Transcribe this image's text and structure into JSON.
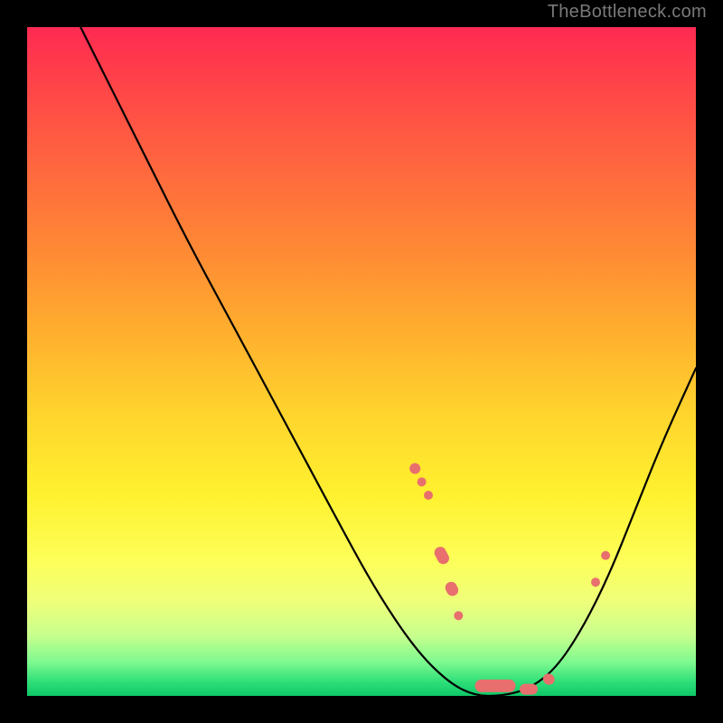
{
  "watermark": "TheBottleneck.com",
  "gradient_colors": {
    "top": "#ff2a52",
    "mid": "#ffd52d",
    "bottom": "#0dc867"
  },
  "chart_data": {
    "type": "line",
    "title": "",
    "xlabel": "",
    "ylabel": "",
    "xlim": [
      0,
      100
    ],
    "ylim": [
      0,
      100
    ],
    "series": [
      {
        "name": "bottleneck-curve",
        "color": "#000000",
        "x": [
          8,
          12,
          18,
          24,
          31,
          38,
          46,
          52,
          58,
          63,
          67,
          71,
          75,
          79,
          83,
          87,
          91,
          95,
          100
        ],
        "y": [
          100,
          92,
          80,
          68,
          55,
          42,
          27,
          16,
          7,
          2,
          0,
          0,
          1,
          4,
          10,
          18,
          28,
          38,
          49
        ]
      }
    ],
    "markers": [
      {
        "name": "mark-left-a",
        "x": 58,
        "y": 34,
        "r": 1.2,
        "shape": "pill",
        "len": 3
      },
      {
        "name": "mark-left-b",
        "x": 59,
        "y": 32,
        "r": 1.0,
        "shape": "dot"
      },
      {
        "name": "mark-left-c",
        "x": 60,
        "y": 30,
        "r": 1.0,
        "shape": "dot"
      },
      {
        "name": "mark-mid-a",
        "x": 62,
        "y": 21,
        "r": 1.3,
        "shape": "pill",
        "len": 5
      },
      {
        "name": "mark-mid-b",
        "x": 63.5,
        "y": 16,
        "r": 1.3,
        "shape": "pill",
        "len": 4
      },
      {
        "name": "mark-mid-c",
        "x": 64.5,
        "y": 12,
        "r": 1.0,
        "shape": "dot"
      },
      {
        "name": "mark-min-a",
        "x": 70,
        "y": 1.5,
        "r": 1.4,
        "shape": "pill-h",
        "len": 9
      },
      {
        "name": "mark-min-b",
        "x": 75,
        "y": 1.0,
        "r": 1.2,
        "shape": "pill-h",
        "len": 4
      },
      {
        "name": "mark-up-a",
        "x": 78,
        "y": 2.5,
        "r": 1.3,
        "shape": "pill",
        "len": 3
      },
      {
        "name": "mark-up-b",
        "x": 85,
        "y": 17,
        "r": 1.0,
        "shape": "dot"
      },
      {
        "name": "mark-up-c",
        "x": 86.5,
        "y": 21,
        "r": 1.0,
        "shape": "dot"
      }
    ]
  }
}
